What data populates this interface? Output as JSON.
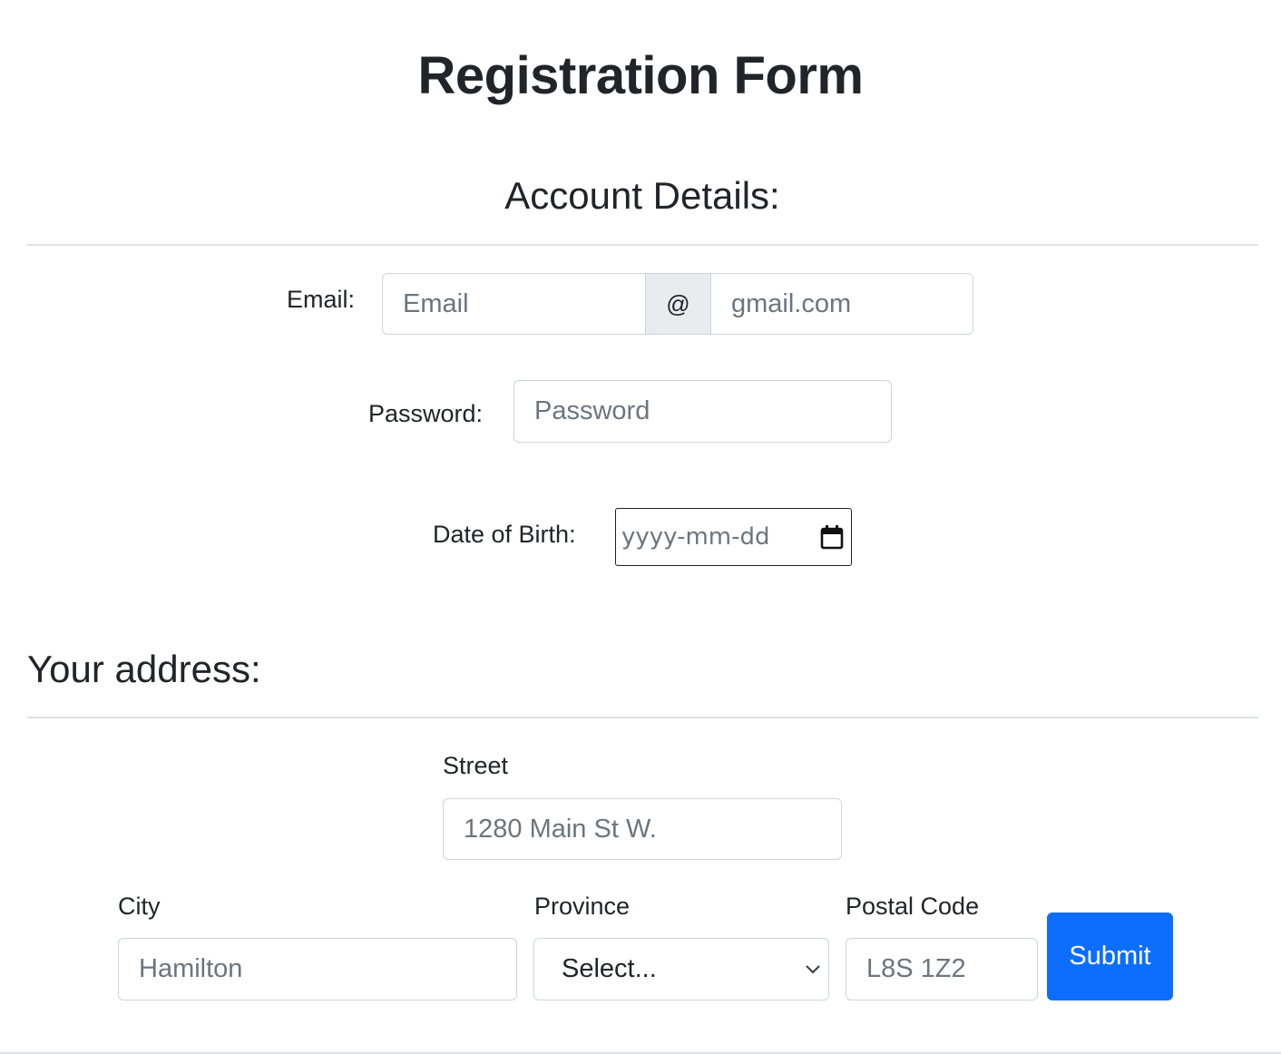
{
  "page_title": "Registration Form",
  "account": {
    "heading": "Account Details:",
    "email": {
      "label": "Email:",
      "placeholder": "Email",
      "addon": "@",
      "domain_placeholder": "gmail.com"
    },
    "password": {
      "label": "Password:",
      "placeholder": "Password"
    },
    "dob": {
      "label": "Date of Birth:",
      "placeholder": "yyyy-mm-dd"
    }
  },
  "address": {
    "heading": "Your address:",
    "street": {
      "label": "Street",
      "placeholder": "1280 Main St W."
    },
    "city": {
      "label": "City",
      "placeholder": "Hamilton"
    },
    "province": {
      "label": "Province",
      "selected": "Select..."
    },
    "postal": {
      "label": "Postal Code",
      "placeholder": "L8S 1Z2"
    }
  },
  "submit_label": "Submit",
  "colors": {
    "primary": "#0d6efd",
    "text": "#212529",
    "muted": "#6c757d",
    "border": "#ced4da",
    "addon_bg": "#e9ecef"
  }
}
